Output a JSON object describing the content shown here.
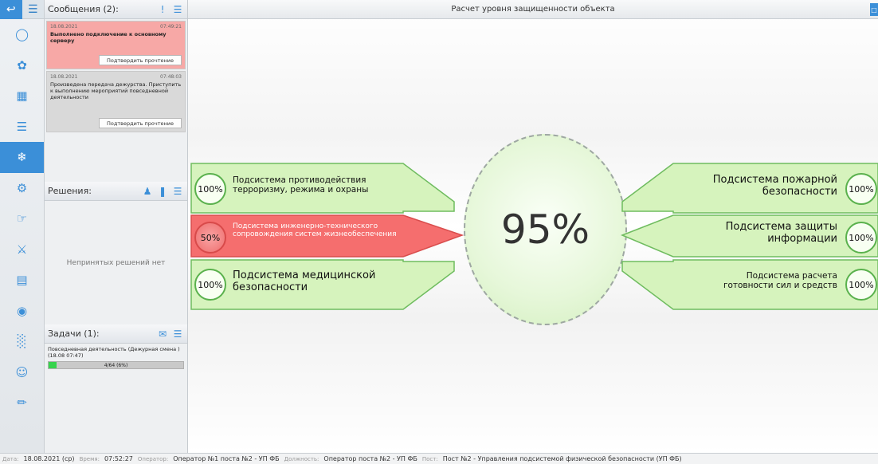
{
  "rail": {
    "top_icons": [
      "back-icon",
      "menu-icon"
    ],
    "items": [
      "gamepad-icon",
      "network-icon",
      "equipment-icon",
      "layers-icon",
      "globe-icon",
      "people-network-icon",
      "touch-icon",
      "camera-icon",
      "document-icon",
      "sphere-icon",
      "bar-chart-icon",
      "gas-mask-icon",
      "pen-icon"
    ],
    "active_index": 4
  },
  "messages": {
    "title": "Сообщения (2):",
    "items": [
      {
        "date": "18.08.2021",
        "time": "07:49:21",
        "text": "Выполнено подключение к основному серверу",
        "button": "Подтвердить прочтение"
      },
      {
        "date": "18.08.2021",
        "time": "07:48:03",
        "text": "Произведена передача дежурства. Приступить к выполнению мероприятий повседневной деятельности",
        "button": "Подтвердить прочтение"
      }
    ]
  },
  "decisions": {
    "title": "Решения:",
    "empty": "Непринятых решений нет"
  },
  "tasks": {
    "title": "Задачи (1):",
    "items": [
      {
        "text": "Повседневная деятельность (Дежурная смена ) (18.08 07:47)",
        "progress_label": "4/64 (6%)",
        "progress": 0.06
      }
    ]
  },
  "main": {
    "title": "Расчет уровня защищенности объекта",
    "total": "95%",
    "left": [
      {
        "pct": "100%",
        "name": "Подсистема противодействия терроризму, режима и охраны",
        "status": "ok"
      },
      {
        "pct": "50%",
        "name": "Подсистема инженерно-технического сопровождения систем жизнеобеспечения",
        "status": "bad"
      },
      {
        "pct": "100%",
        "name": "Подсистема медицинской безопасности",
        "status": "ok"
      }
    ],
    "right": [
      {
        "pct": "100%",
        "name": "Подсистема пожарной безопасности",
        "status": "ok"
      },
      {
        "pct": "100%",
        "name": "Подсистема защиты информации",
        "status": "ok"
      },
      {
        "pct": "100%",
        "name": "Подсистема расчета готовности сил и средств",
        "status": "ok"
      }
    ]
  },
  "status": {
    "date_label": "Дата:",
    "date": "18.08.2021 (ср)",
    "time_label": "Время:",
    "time": "07:52:27",
    "operator_label": "Оператор:",
    "operator": "Оператор №1 поста №2 - УП ФБ",
    "position_label": "Должность:",
    "position": "Оператор поста №2 - УП ФБ",
    "post_label": "Пост:",
    "post": "Пост №2 - Управления подсистемой физической безопасности (УП ФБ)"
  },
  "colors": {
    "accent": "#3b8fd8",
    "ok": "#c9f0a7",
    "bad": "#ef6e6e"
  }
}
